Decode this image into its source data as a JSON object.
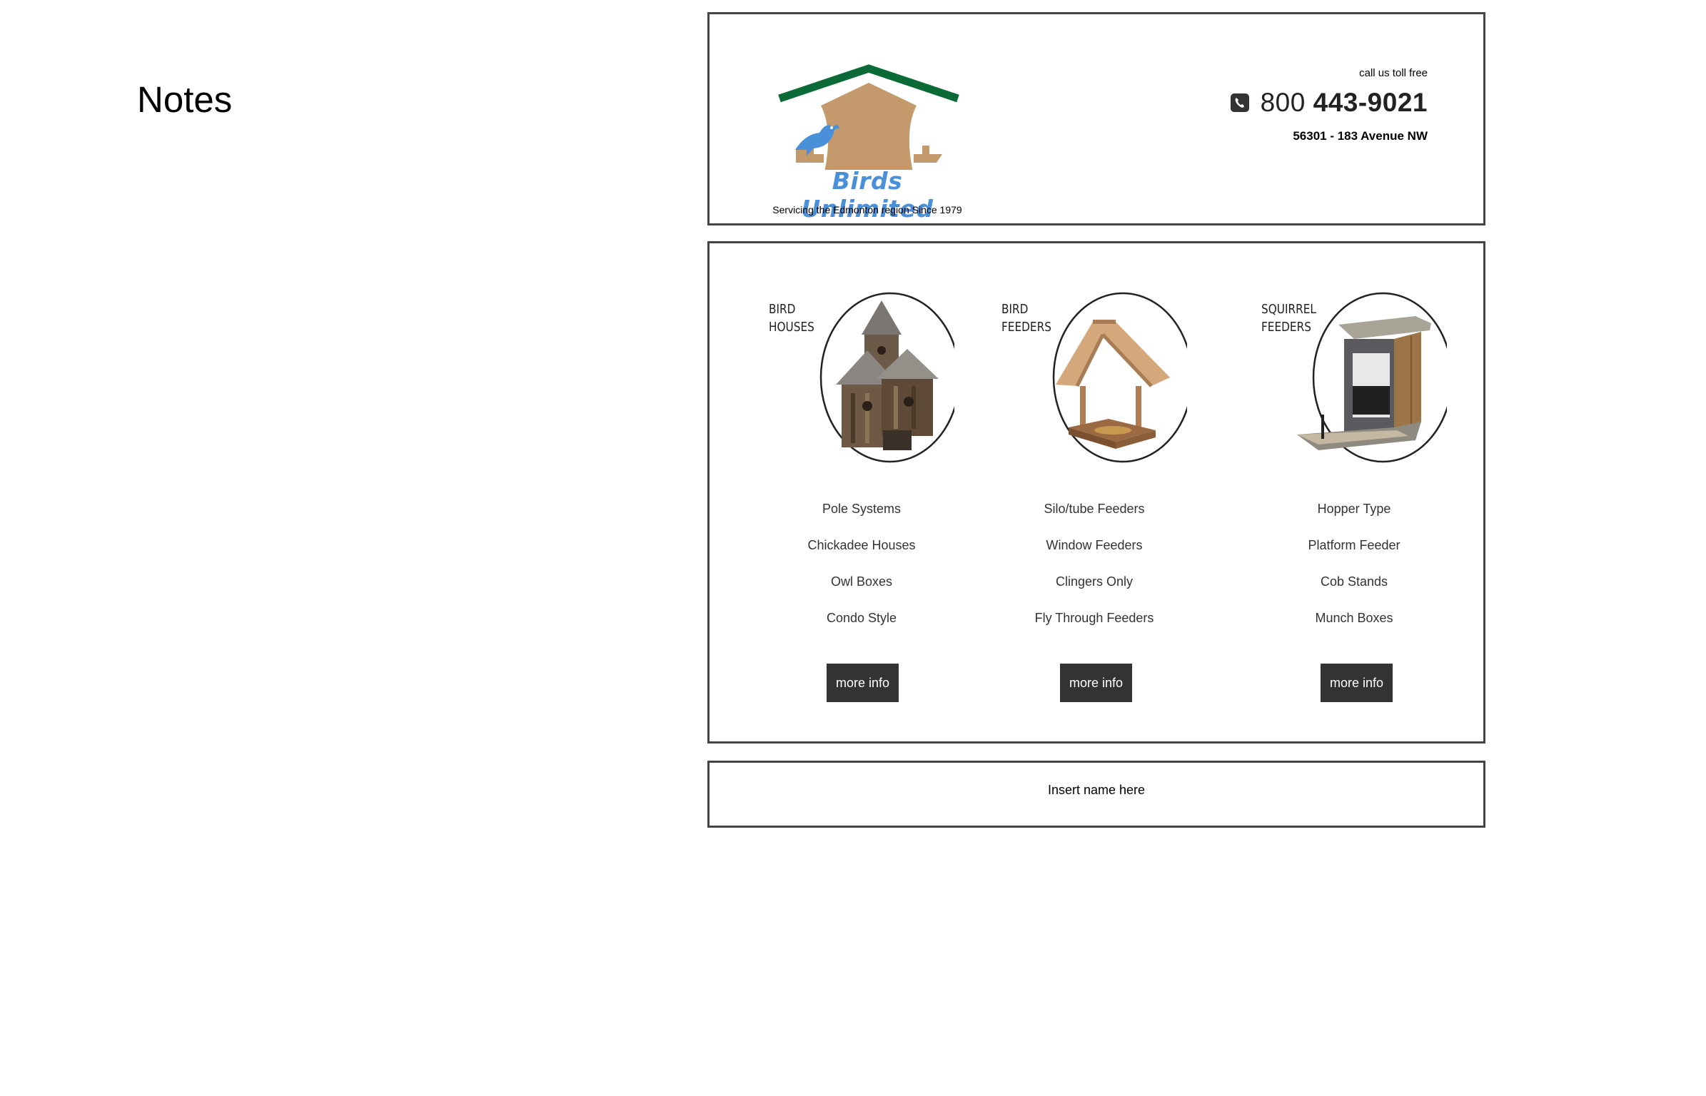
{
  "notes": {
    "title": "Notes"
  },
  "header": {
    "logo": {
      "name": "Birds Unlimited",
      "tagline": "Servicing the Edmonton region Since 1979",
      "icon": "birdhouse-logo-icon",
      "colors": {
        "roof": "#0a6b36",
        "house": "#c49a6c",
        "bird": "#4a90d9"
      }
    },
    "contact": {
      "toll_free_label": "call us toll free",
      "phone_icon": "phone-icon",
      "phone_prefix": "800",
      "phone_number": "443-9021",
      "address": "56301 - 183 Avenue NW"
    }
  },
  "products": [
    {
      "label_line1": "BIRD",
      "label_line2": "HOUSES",
      "image_icon": "birdhouse-image",
      "items": [
        "Pole Systems",
        "Chickadee Houses",
        "Owl Boxes",
        "Condo Style"
      ],
      "button_label": "more info"
    },
    {
      "label_line1": "BIRD",
      "label_line2": "FEEDERS",
      "image_icon": "bird-feeder-image",
      "items": [
        "Silo/tube Feeders",
        "Window Feeders",
        "Clingers Only",
        "Fly Through Feeders"
      ],
      "button_label": "more info"
    },
    {
      "label_line1": "SQUIRREL",
      "label_line2": "FEEDERS",
      "image_icon": "squirrel-feeder-image",
      "items": [
        "Hopper Type",
        "Platform Feeder",
        "Cob Stands",
        "Munch Boxes"
      ],
      "button_label": "more info"
    }
  ],
  "footer": {
    "text": "Insert name here"
  },
  "colors": {
    "border": "#444444",
    "button_bg": "#333333",
    "button_text": "#ffffff"
  }
}
